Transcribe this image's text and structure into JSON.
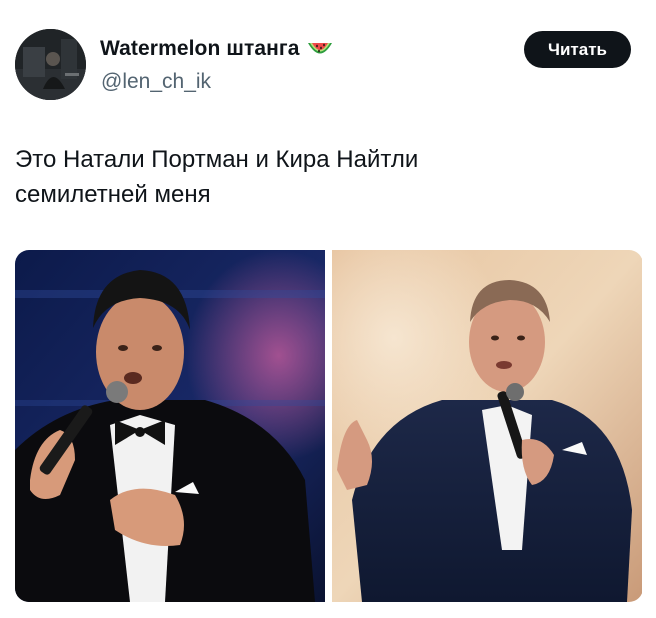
{
  "author": {
    "display_name": "Watermelon штанга",
    "name_emoji": "watermelon-emoji",
    "handle": "@len_ch_ik",
    "avatar": "avatar-photo"
  },
  "follow_button": {
    "label": "Читать"
  },
  "tweet": {
    "text": "Это Натали Портман и Кира Найтли\nсемилетней меня"
  },
  "media": [
    {
      "name": "singer-photo-left",
      "background": "#101c48"
    },
    {
      "name": "singer-photo-right",
      "background": "#e8c9a2"
    }
  ],
  "colors": {
    "text": "#0f1419",
    "secondary": "#536471",
    "button_bg": "#0f1419",
    "button_text": "#ffffff"
  }
}
